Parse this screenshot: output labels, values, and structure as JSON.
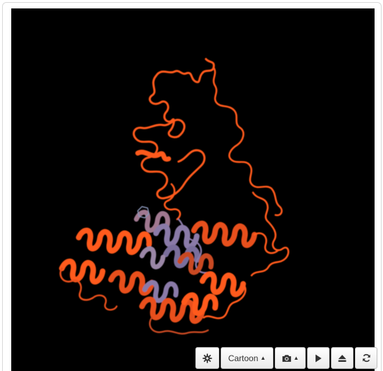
{
  "viewer": {
    "background": "#000000",
    "ribbon_colors": [
      "#ff5a1a",
      "#e8501a",
      "#c94a24",
      "#8a7aa8"
    ]
  },
  "toolbar": {
    "settings_icon": "gear-icon",
    "representation_label": "Cartoon",
    "representation_caret": "▲",
    "screenshot_icon": "camera-icon",
    "screenshot_caret": "▲",
    "spin_icon": "play-icon",
    "eject_icon": "eject-icon",
    "reset_icon": "refresh-icon"
  }
}
